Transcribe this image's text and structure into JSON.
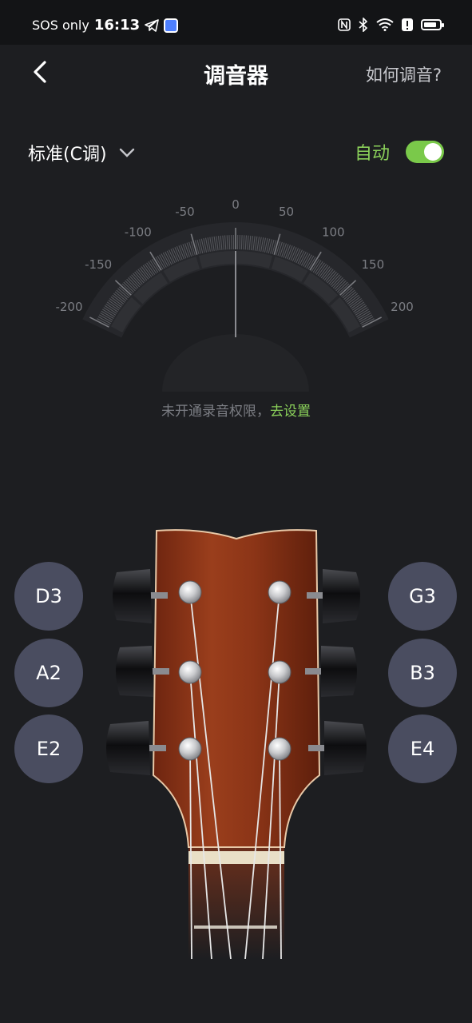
{
  "status_bar": {
    "carrier": "SOS only",
    "time": "16:13"
  },
  "header": {
    "title": "调音器",
    "help_link": "如何调音?"
  },
  "tuning_mode": {
    "selected": "标准(C调)",
    "auto_label": "自动",
    "auto_enabled": true
  },
  "gauge": {
    "labels": [
      "-200",
      "-150",
      "-100",
      "-50",
      "0",
      "50",
      "100",
      "150",
      "200"
    ],
    "needle_cents": 0
  },
  "permission_hint": {
    "text": "未开通录音权限，",
    "link": "去设置"
  },
  "strings": {
    "left": [
      "D3",
      "A2",
      "E2"
    ],
    "right": [
      "G3",
      "B3",
      "E4"
    ]
  },
  "colors": {
    "background": "#1d1e21",
    "accent": "#8bd15a",
    "note_button": "#4a4d60",
    "headstock": "#8a3418"
  }
}
